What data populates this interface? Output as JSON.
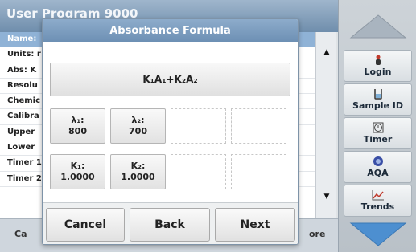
{
  "background": {
    "title": "User Program 9000",
    "rows": [
      "Name:",
      "Units: r",
      "Abs: K",
      "Resolu",
      "Chemic",
      "Calibra",
      "Upper",
      "Lower",
      "Timer 1",
      "Timer 2"
    ],
    "bottom_left": "Ca",
    "bottom_right": "ore"
  },
  "sidebar": {
    "login_label": "Login",
    "sample_id_label": "Sample ID",
    "timer_label": "Timer",
    "aqa_label": "AQA",
    "trends_label": "Trends"
  },
  "dialog": {
    "title": "Absorbance Formula",
    "formula": "K₁A₁+K₂A₂",
    "lambda1_label": "λ₁:",
    "lambda1_value": "800",
    "lambda2_label": "λ₂:",
    "lambda2_value": "700",
    "k1_label": "K₁:",
    "k1_value": "1.0000",
    "k2_label": "K₂:",
    "k2_value": "1.0000",
    "cancel_label": "Cancel",
    "back_label": "Back",
    "next_label": "Next"
  },
  "colors": {
    "header_blue": "#6d90b4",
    "selected_row": "#8fb2d6",
    "nav_arrow_grey": "#a9b4bf",
    "nav_arrow_blue": "#4d8fd0"
  }
}
